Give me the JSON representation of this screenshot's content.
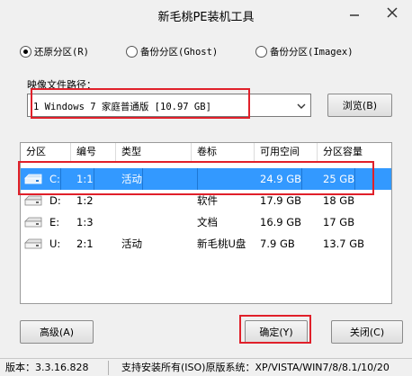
{
  "window": {
    "title": "新毛桃PE装机工具"
  },
  "mode": {
    "restore_label": "还原分区(R)",
    "backup_ghost_label": "备份分区(Ghost)",
    "backup_imagex_label": "备份分区(Imagex)",
    "selected": "restore"
  },
  "image_path": {
    "label": "映像文件路径：",
    "value": "1 Windows 7 家庭普通版 [10.97 GB]",
    "browse_label": "浏览(B)"
  },
  "table": {
    "headers": [
      "分区",
      "编号",
      "类型",
      "卷标",
      "可用空间",
      "分区容量"
    ],
    "rows": [
      {
        "drive": "C:",
        "number": "1:1",
        "type": "活动",
        "label": "",
        "free": "24.9 GB",
        "size": "25 GB",
        "selected": true
      },
      {
        "drive": "D:",
        "number": "1:2",
        "type": "",
        "label": "软件",
        "free": "17.9 GB",
        "size": "18 GB",
        "selected": false
      },
      {
        "drive": "E:",
        "number": "1:3",
        "type": "",
        "label": "文档",
        "free": "16.9 GB",
        "size": "17 GB",
        "selected": false
      },
      {
        "drive": "U:",
        "number": "2:1",
        "type": "活动",
        "label": "新毛桃U盘",
        "free": "7.9 GB",
        "size": "13.7 GB",
        "selected": false
      }
    ]
  },
  "buttons": {
    "advanced": "高级(A)",
    "ok": "确定(Y)",
    "close": "关闭(C)"
  },
  "status": {
    "version": "版本：3.3.16.828",
    "support": "支持安装所有(ISO)原版系统：XP/VISTA/WIN7/8/8.1/10/20"
  },
  "colors": {
    "selection": "#3399ff",
    "highlight_box": "#e0202a"
  }
}
